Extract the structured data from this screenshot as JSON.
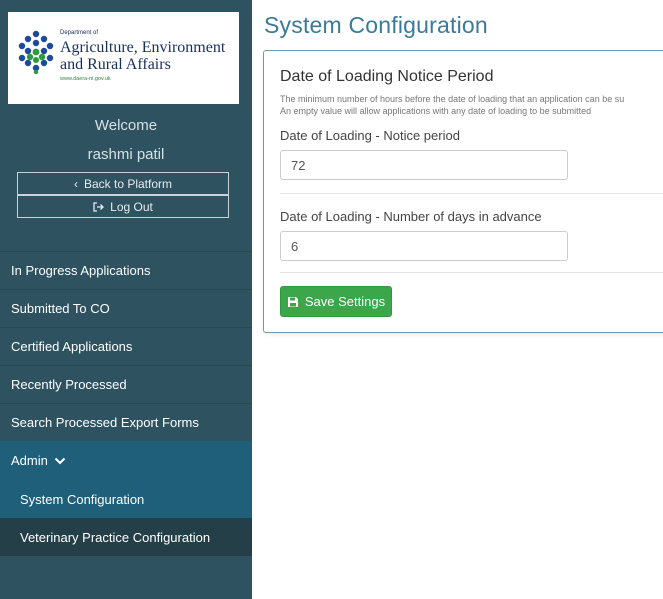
{
  "logo": {
    "dept": "Department of",
    "line1": "Agriculture, Environment",
    "line2": "and Rural Affairs",
    "url": "www.daera-ni.gov.uk"
  },
  "sidebar": {
    "welcome": "Welcome",
    "username": "rashmi patil",
    "back_label": "Back to Platform",
    "logout_label": "Log Out",
    "items": [
      {
        "label": "In Progress Applications"
      },
      {
        "label": "Submitted To CO"
      },
      {
        "label": "Certified Applications"
      },
      {
        "label": "Recently Processed"
      },
      {
        "label": "Search Processed Export Forms"
      }
    ],
    "admin_label": "Admin",
    "sub_items": [
      {
        "label": "System Configuration"
      },
      {
        "label": "Veterinary Practice Configuration"
      }
    ]
  },
  "main": {
    "title": "System Configuration",
    "card": {
      "title": "Date of Loading Notice Period",
      "desc1": "The minimum number of hours before the date of loading that an application can be su",
      "desc2": "An empty value will allow applications with any date of loading to be submitted",
      "field1_label": "Date of Loading - Notice period",
      "field1_value": "72",
      "field2_label": "Date of Loading - Number of days in advance",
      "field2_value": "6",
      "save_label": "Save Settings"
    }
  },
  "colors": {
    "sidebar_bg": "#2e5260",
    "admin_bg": "#1f5f79",
    "active_bg": "#243f48",
    "title_blue": "#3b7a99",
    "save_green": "#3ca64a"
  }
}
